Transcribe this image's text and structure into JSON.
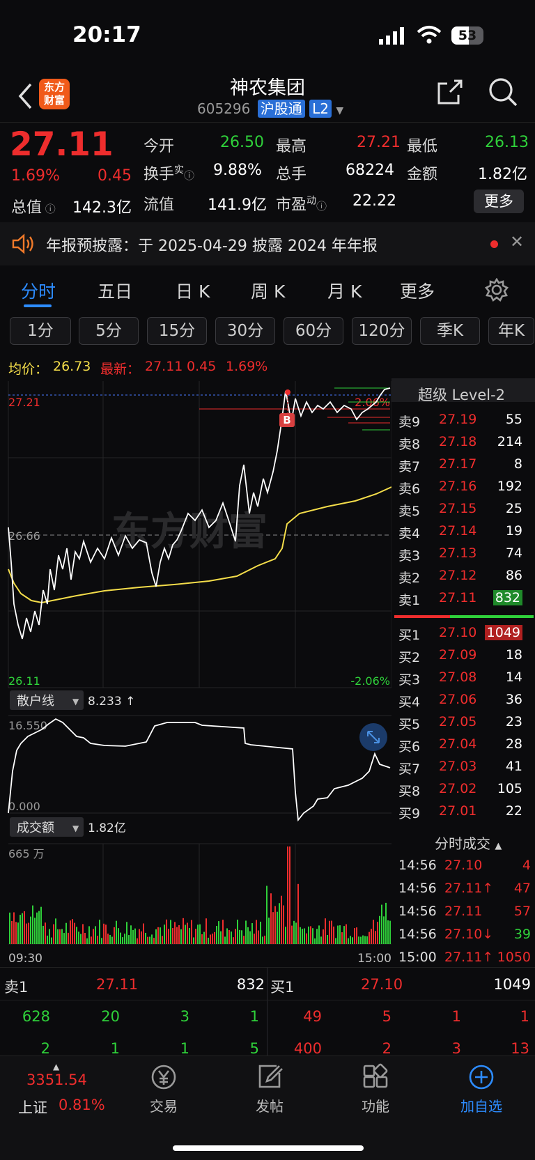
{
  "status": {
    "time": "20:17",
    "battery": "53"
  },
  "header": {
    "brand_line1": "东方",
    "brand_line2": "财富",
    "title": "神农集团",
    "code": "605296",
    "tag1": "沪股通",
    "tag2": "L2"
  },
  "quote": {
    "price": "27.11",
    "pct": "1.69%",
    "chg": "0.45",
    "open_label": "今开",
    "open": "26.50",
    "high_label": "最高",
    "high": "27.21",
    "low_label": "最低",
    "low": "26.13",
    "turnover_label": "换手",
    "turnover_sup": "实",
    "turnover": "9.88%",
    "vol_label": "总手",
    "vol": "68224",
    "amt_label": "金额",
    "amt": "1.82亿",
    "mktcap_label": "总值",
    "mktcap": "142.3亿",
    "float_label": "流值",
    "float": "141.9亿",
    "pe_label": "市盈",
    "pe_sup": "动",
    "pe": "22.22",
    "more": "更多"
  },
  "notice": {
    "text": "年报预披露：于 2025-04-29 披露 2024 年年报"
  },
  "tabs": [
    "分时",
    "五日",
    "日 K",
    "周 K",
    "月 K",
    "更多"
  ],
  "pills": [
    "1分",
    "5分",
    "15分",
    "30分",
    "60分",
    "120分",
    "季K",
    "年K"
  ],
  "chartinfo": {
    "avg_label": "均价：",
    "avg": "26.73",
    "last_label": "最新：",
    "last": "27.11",
    "chg": "0.45",
    "pct": "1.69%"
  },
  "chart_data": {
    "type": "line",
    "price_axis": {
      "top": "27.21",
      "mid": "26.66",
      "bottom": "26.11",
      "pct_top": "2.06%",
      "pct_bottom": "-2.06%",
      "ylim": [
        26.11,
        27.21
      ]
    },
    "marker": "B",
    "retail": {
      "label": "散户线",
      "value": "8.233 ↑",
      "max": "16.550",
      "min": "0.000"
    },
    "volume": {
      "label": "成交额",
      "value": "1.82亿",
      "max": "665 万",
      "x_start": "09:30",
      "x_end": "15:00"
    }
  },
  "level2": {
    "title": "超级 Level-2",
    "asks": [
      [
        "卖9",
        "27.19",
        "55"
      ],
      [
        "卖8",
        "27.18",
        "214"
      ],
      [
        "卖7",
        "27.17",
        "8"
      ],
      [
        "卖6",
        "27.16",
        "192"
      ],
      [
        "卖5",
        "27.15",
        "25"
      ],
      [
        "卖4",
        "27.14",
        "19"
      ],
      [
        "卖3",
        "27.13",
        "74"
      ],
      [
        "卖2",
        "27.12",
        "86"
      ],
      [
        "卖1",
        "27.11",
        "832"
      ]
    ],
    "bids": [
      [
        "买1",
        "27.10",
        "1049"
      ],
      [
        "买2",
        "27.09",
        "18"
      ],
      [
        "买3",
        "27.08",
        "14"
      ],
      [
        "买4",
        "27.06",
        "36"
      ],
      [
        "买5",
        "27.05",
        "23"
      ],
      [
        "买6",
        "27.04",
        "28"
      ],
      [
        "买7",
        "27.03",
        "41"
      ],
      [
        "买8",
        "27.02",
        "105"
      ],
      [
        "买9",
        "27.01",
        "22"
      ]
    ],
    "trades_title": "分时成交",
    "trades": [
      [
        "14:56",
        "27.10",
        "4"
      ],
      [
        "14:56",
        "27.11↑",
        "47"
      ],
      [
        "14:56",
        "27.11",
        "57"
      ],
      [
        "14:56",
        "27.10↓",
        "39"
      ],
      [
        "15:00",
        "27.11↑",
        "1050"
      ]
    ]
  },
  "orderbar": {
    "sell_label": "卖1",
    "sell_price": "27.11",
    "sell_vol": "832",
    "buy_label": "买1",
    "buy_price": "27.10",
    "buy_vol": "1049",
    "sell_q1": [
      "628",
      "20",
      "3",
      "1"
    ],
    "sell_q2": [
      "2",
      "1",
      "1",
      "5"
    ],
    "buy_q1": [
      "49",
      "5",
      "1",
      "1"
    ],
    "buy_q2": [
      "400",
      "2",
      "3",
      "13"
    ]
  },
  "bottom": {
    "index_value": "3351.54",
    "index_name": "上证",
    "index_pct": "0.81%",
    "nav": [
      "交易",
      "发帖",
      "功能",
      "加自选"
    ]
  }
}
